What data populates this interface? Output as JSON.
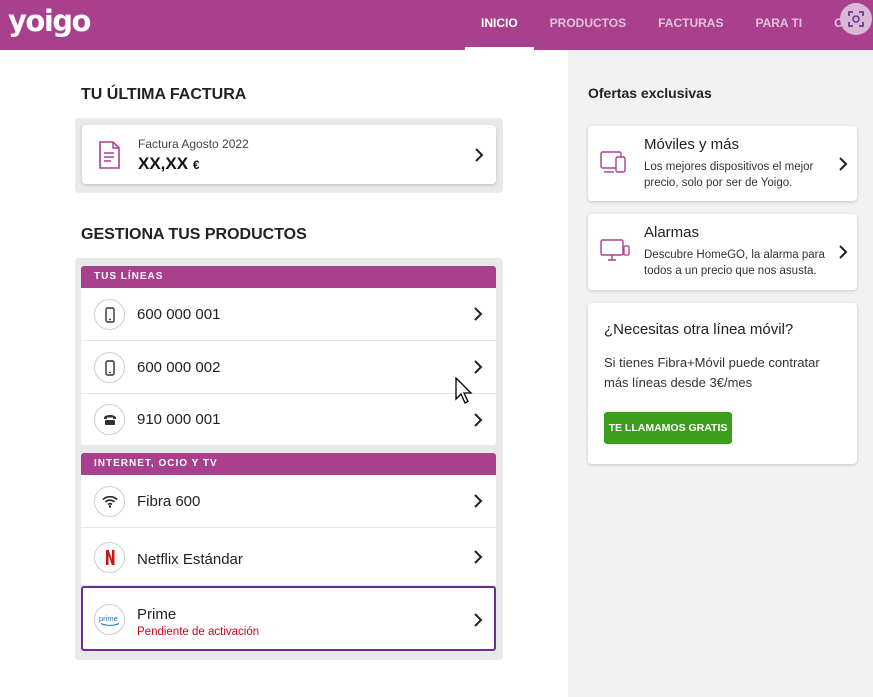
{
  "header": {
    "logo": "yoigo",
    "nav": [
      {
        "label": "INICIO",
        "active": true
      },
      {
        "label": "PRODUCTOS",
        "active": false
      },
      {
        "label": "FACTURAS",
        "active": false
      },
      {
        "label": "PARA TI",
        "active": false
      },
      {
        "label": "CUENTA",
        "active": false
      }
    ]
  },
  "invoice": {
    "section_title": "TU ÚLTIMA FACTURA",
    "label": "Factura Agosto 2022",
    "amount": "XX,XX",
    "currency": "€"
  },
  "products": {
    "section_title": "GESTIONA TUS PRODUCTOS",
    "lines_header": "TUS LÍNEAS",
    "lines": [
      {
        "label": "600 000 001",
        "icon": "mobile-icon"
      },
      {
        "label": "600 000 002",
        "icon": "mobile-icon"
      },
      {
        "label": "910 000 001",
        "icon": "landline-icon"
      }
    ],
    "services_header": "INTERNET, OCIO Y TV",
    "services": [
      {
        "label": "Fibra 600",
        "icon": "wifi-icon"
      },
      {
        "label": "Netflix Estándar",
        "icon": "netflix-icon"
      },
      {
        "label": "Prime",
        "sub": "Pendiente de activación",
        "icon": "prime-icon"
      }
    ]
  },
  "offers": {
    "section_title": "Ofertas exclusivas",
    "items": [
      {
        "title": "Móviles y más",
        "desc": "Los mejores dispositivos el mejor precio, solo por ser de Yoigo.",
        "icon": "devices-icon"
      },
      {
        "title": "Alarmas",
        "desc": "Descubre HomeGO, la alarma para todos a un precio que nos asusta.",
        "icon": "alarm-monitor-icon"
      }
    ]
  },
  "cta": {
    "title": "¿Necesitas otra línea móvil?",
    "text": "Si tienes Fibra+Móvil puede contratar más líneas desde 3€/mes",
    "button": "TE LLAMAMOS GRATIS"
  },
  "colors": {
    "brand": "#a9408e",
    "cta_green": "#3a9f1a",
    "pending_red": "#d0021b",
    "highlight_border": "#6a2f8e"
  }
}
